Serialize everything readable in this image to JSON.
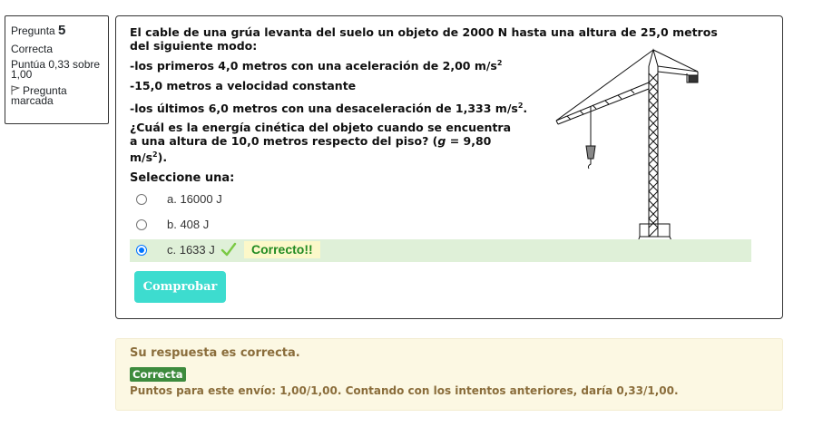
{
  "info": {
    "question_label": "Pregunta",
    "question_number": "5",
    "state": "Correcta",
    "grade": "Puntúa 0,33 sobre 1,00",
    "flag_label": "Pregunta marcada"
  },
  "question": {
    "intro": "El cable de una grúa levanta del suelo un objeto de 2000 N hasta una altura de 25,0 metros del siguiente modo:",
    "line1": "-los primeros 4,0 metros con una aceleración de 2,00 m/s",
    "line1_exp": "2",
    "line2": "-15,0 metros a velocidad constante",
    "line3": "-los últimos 6,0 metros con una desaceleración de 1,333 m/s",
    "line3_exp": "2",
    "line3_end": ".",
    "ask_part1": "¿Cuál es la energía cinética del objeto cuando se encuentra a una altura de 10,0 metros respecto del piso? (",
    "ask_g": "g",
    "ask_part2": " = 9,80 m/s",
    "ask_exp": "2",
    "ask_end": ")."
  },
  "prompt": "Seleccione una:",
  "answers": [
    {
      "label": "a. 16000 J",
      "selected": false
    },
    {
      "label": "b. 408 J",
      "selected": false
    },
    {
      "label": "c. 1633 J",
      "selected": true
    }
  ],
  "feedback_inline": "Correcto!!",
  "check_button": "Comprobar",
  "outcome": {
    "response_text": "Su respuesta es correcta.",
    "badge": "Correcta",
    "points": "Puntos para este envío: 1,00/1,00. Contando con los intentos anteriores, daría 0,33/1,00."
  },
  "colors": {
    "accent_button": "#3ddccf",
    "correct_bg": "#dff0d8",
    "feedback_highlight": "#fcf8c9",
    "outcome_bg": "#fcf8e3",
    "badge_bg": "#3d8b3d"
  },
  "icons": [
    "flag-icon",
    "check-icon",
    "crane-image"
  ]
}
